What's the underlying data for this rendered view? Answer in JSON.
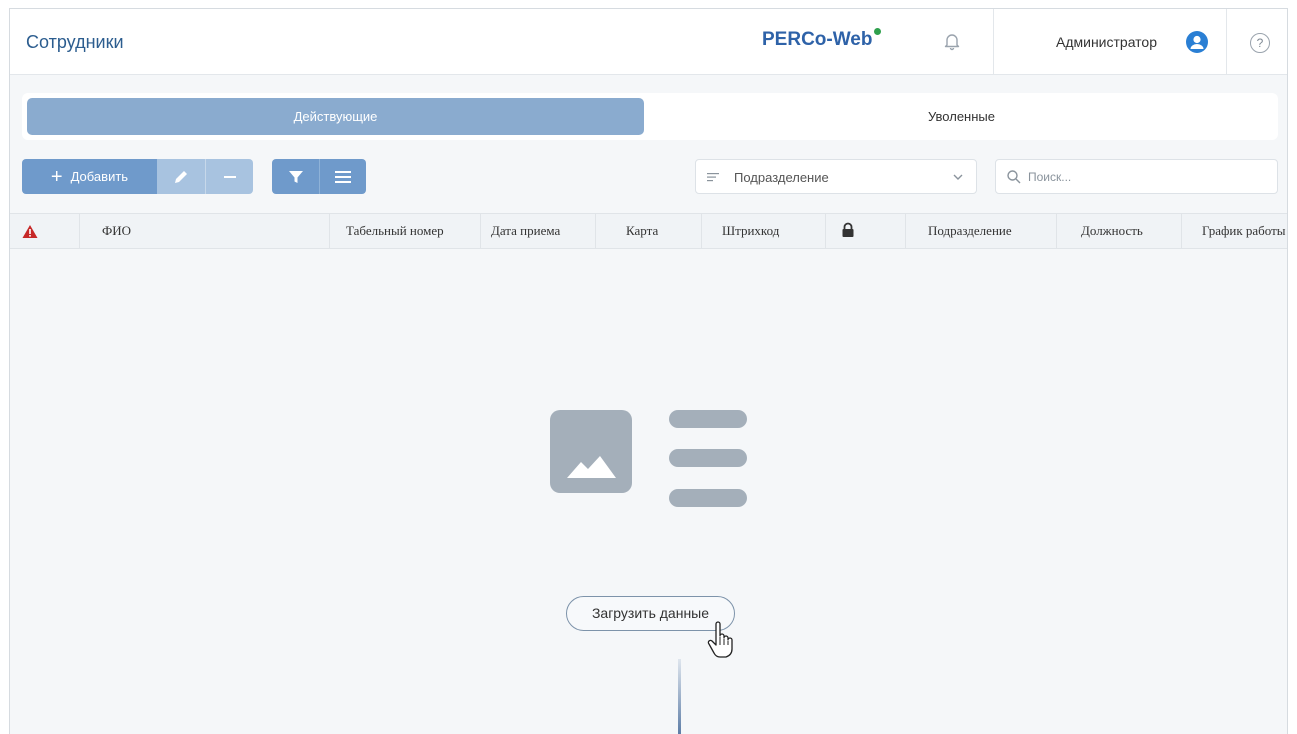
{
  "header": {
    "title": "Сотрудники",
    "logo_text": "PERCo-Web",
    "user_name": "Администратор",
    "help_label": "?",
    "icons": [
      "bell-icon",
      "user-avatar-icon",
      "help-icon"
    ]
  },
  "tabs": [
    {
      "label": "Действующие",
      "active": true
    },
    {
      "label": "Уволенные",
      "active": false
    }
  ],
  "toolbar": {
    "add_label": "Добавить",
    "department_label": "Подразделение",
    "search_placeholder": "Поиск..."
  },
  "table": {
    "columns": [
      "ФИО",
      "Табельный номер",
      "Дата приема",
      "Карта",
      "Штрихкод",
      "Подразделение",
      "Должность",
      "График работы"
    ]
  },
  "empty_state": {
    "load_button_label": "Загрузить данные"
  },
  "colors": {
    "accent": "#6f9acb",
    "active_tab": "#8aabcf",
    "title": "#2c5d8f",
    "warning": "#c62828",
    "logo_dot": "#2fa04d"
  }
}
